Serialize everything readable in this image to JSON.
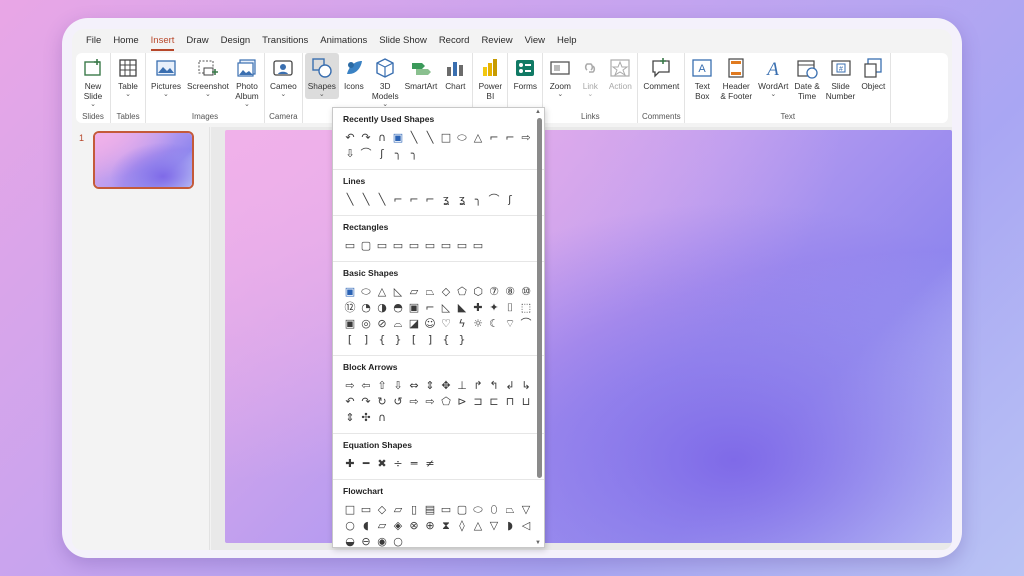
{
  "tabs": [
    "File",
    "Home",
    "Insert",
    "Draw",
    "Design",
    "Transitions",
    "Animations",
    "Slide Show",
    "Record",
    "Review",
    "View",
    "Help"
  ],
  "active_tab": "Insert",
  "ribbon": {
    "groups": [
      {
        "label": "Slides",
        "buttons": [
          {
            "label": "New\nSlide",
            "caret": "⌄",
            "icon": "new-slide-icon"
          }
        ]
      },
      {
        "label": "Tables",
        "buttons": [
          {
            "label": "Table",
            "caret": "⌄",
            "icon": "table-icon"
          }
        ]
      },
      {
        "label": "Images",
        "buttons": [
          {
            "label": "Pictures",
            "caret": "⌄",
            "icon": "pictures-icon"
          },
          {
            "label": "Screenshot",
            "caret": "⌄",
            "icon": "screenshot-icon"
          },
          {
            "label": "Photo\nAlbum",
            "caret": "⌄",
            "icon": "photo-album-icon"
          }
        ]
      },
      {
        "label": "Camera",
        "buttons": [
          {
            "label": "Cameo",
            "caret": "⌄",
            "icon": "cameo-icon"
          }
        ]
      },
      {
        "label": "",
        "buttons": [
          {
            "label": "Shapes",
            "caret": "⌄",
            "icon": "shapes-icon",
            "selected": true
          },
          {
            "label": "Icons",
            "caret": "",
            "icon": "icons-icon"
          },
          {
            "label": "3D\nModels",
            "caret": "⌄",
            "icon": "3d-models-icon"
          },
          {
            "label": "SmartArt",
            "caret": "",
            "icon": "smartart-icon"
          },
          {
            "label": "Chart",
            "caret": "",
            "icon": "chart-icon"
          }
        ]
      },
      {
        "label": "",
        "buttons": [
          {
            "label": "Power\nBI",
            "caret": "",
            "icon": "power-bi-icon"
          }
        ]
      },
      {
        "label": "Forms",
        "buttons": [
          {
            "label": "Forms",
            "caret": "",
            "icon": "forms-icon"
          }
        ]
      },
      {
        "label": "Links",
        "buttons": [
          {
            "label": "Zoom",
            "caret": "⌄",
            "icon": "zoom-icon"
          },
          {
            "label": "Link",
            "caret": "⌄",
            "icon": "link-icon",
            "disabled": true
          },
          {
            "label": "Action",
            "caret": "",
            "icon": "action-icon",
            "disabled": true
          }
        ]
      },
      {
        "label": "Comments",
        "buttons": [
          {
            "label": "Comment",
            "caret": "",
            "icon": "comment-icon"
          }
        ]
      },
      {
        "label": "Text",
        "buttons": [
          {
            "label": "Text\nBox",
            "caret": "",
            "icon": "text-box-icon"
          },
          {
            "label": "Header\n& Footer",
            "caret": "",
            "icon": "header-footer-icon"
          },
          {
            "label": "WordArt",
            "caret": "⌄",
            "icon": "wordart-icon"
          },
          {
            "label": "Date &\nTime",
            "caret": "",
            "icon": "date-time-icon"
          },
          {
            "label": "Slide\nNumber",
            "caret": "",
            "icon": "slide-number-icon"
          },
          {
            "label": "Object",
            "caret": "",
            "icon": "object-icon"
          }
        ]
      }
    ]
  },
  "slide_panel": {
    "slide_number": "1"
  },
  "shapes_gallery": {
    "sections": [
      {
        "title": "Recently Used Shapes",
        "shapes": [
          "↶",
          "↷",
          "∩",
          "▣",
          "╲",
          "╲",
          "□",
          "⬭",
          "△",
          "⌐",
          "⌐",
          "⇨",
          "⇩",
          "⌒",
          "ʃ",
          "╮",
          "╮"
        ]
      },
      {
        "title": "Lines",
        "shapes": [
          "╲",
          "╲",
          "╲",
          "⌐",
          "⌐",
          "⌐",
          "ʓ",
          "ʓ",
          "╮",
          "⌒",
          "ʃ"
        ]
      },
      {
        "title": "Rectangles",
        "shapes": [
          "▭",
          "▢",
          "▭",
          "▭",
          "▭",
          "▭",
          "▭",
          "▭",
          "▭"
        ]
      },
      {
        "title": "Basic Shapes",
        "shapes": [
          "▣",
          "⬭",
          "△",
          "◺",
          "▱",
          "⏢",
          "◇",
          "⬠",
          "⬡",
          "⑦",
          "⑧",
          "⑩",
          "⑫",
          "◔",
          "◑",
          "◓",
          "▣",
          "⌐",
          "◺",
          "◣",
          "✚",
          "✦",
          "⌷",
          "⬚",
          "▣",
          "◎",
          "⊘",
          "⌓",
          "◪",
          "☺",
          "♡",
          "ϟ",
          "☼",
          "☾",
          "⌔",
          "⌒",
          "[",
          "]",
          "{",
          "}",
          "[",
          "]",
          "{",
          "}"
        ]
      },
      {
        "title": "Block Arrows",
        "shapes": [
          "⇨",
          "⇦",
          "⇧",
          "⇩",
          "⇔",
          "⇕",
          "✥",
          "⊥",
          "↱",
          "↰",
          "↲",
          "↳",
          "↶",
          "↷",
          "↻",
          "↺",
          "⇨",
          "⇨",
          "⬠",
          "⊳",
          "⊐",
          "⊏",
          "⊓",
          "⊔",
          "⇕",
          "✣",
          "∩"
        ]
      },
      {
        "title": "Equation Shapes",
        "shapes": [
          "✚",
          "━",
          "✖",
          "÷",
          "═",
          "≠"
        ]
      },
      {
        "title": "Flowchart",
        "shapes": [
          "□",
          "▭",
          "◇",
          "▱",
          "▯",
          "▤",
          "▭",
          "▢",
          "⬭",
          "⬯",
          "⏢",
          "▽",
          "○",
          "◖",
          "▱",
          "◈",
          "⊗",
          "⊕",
          "⧗",
          "◊",
          "△",
          "▽",
          "◗",
          "◁",
          "◒",
          "⊖",
          "◉",
          "○"
        ]
      }
    ]
  }
}
